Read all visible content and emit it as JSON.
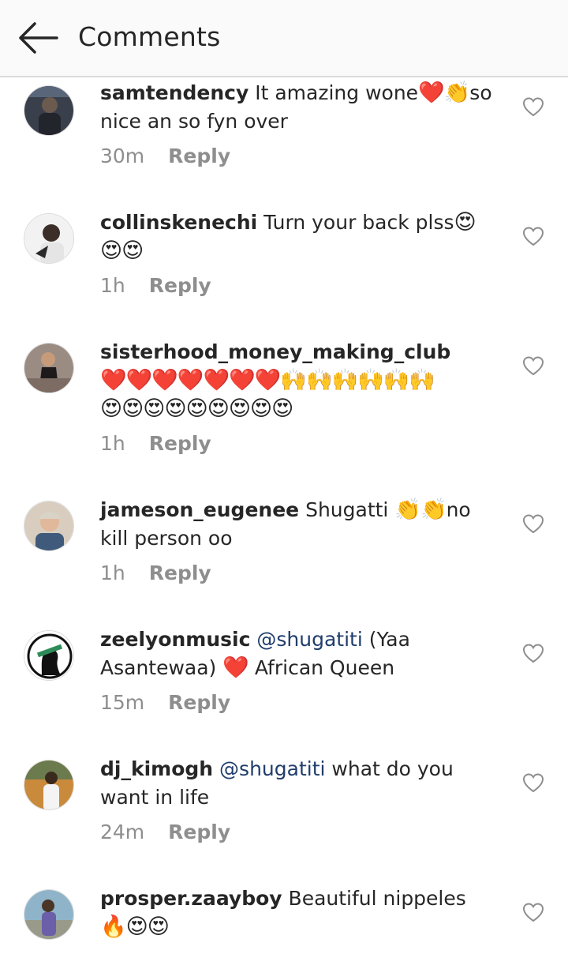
{
  "header": {
    "title": "Comments",
    "back_icon": "arrow-left-icon"
  },
  "reply_label": "Reply",
  "colors": {
    "mention": "#1f3d6b",
    "meta": "#8e8e8e",
    "text": "#262626"
  },
  "comments": [
    {
      "username": "samtendency",
      "text_before": " It amazing wone",
      "emoji_1": "❤️👏",
      "text_after": "so nice an so fyn over",
      "time": "30m"
    },
    {
      "username": "collinskenechi",
      "text_before": " Turn your back plss",
      "emoji_1": "😍😍😍",
      "time": "1h"
    },
    {
      "username": "sisterhood_money_making_club",
      "emoji_1": "❤️❤️❤️❤️❤️❤️❤️🙌🙌🙌🙌🙌🙌",
      "emoji_2": "😍😍😍😍😍😍😍😍😍",
      "time": "1h"
    },
    {
      "username": "jameson_eugenee",
      "text_before": " Shugatti ",
      "emoji_1": "👏👏",
      "text_after": "no kill person oo",
      "time": "1h"
    },
    {
      "username": "zeelyonmusic",
      "mention": "@shugatiti",
      "text_before": " (Yaa Asantewaa) ",
      "emoji_1": "❤️",
      "text_after": " African Queen",
      "time": "15m"
    },
    {
      "username": "dj_kimogh",
      "mention": "@shugatiti",
      "text_before": " what do you want in life",
      "time": "24m"
    },
    {
      "username": "prosper.zaayboy",
      "text_before": " Beautiful nippeles",
      "emoji_1": "🔥😍😍",
      "time": ""
    }
  ]
}
